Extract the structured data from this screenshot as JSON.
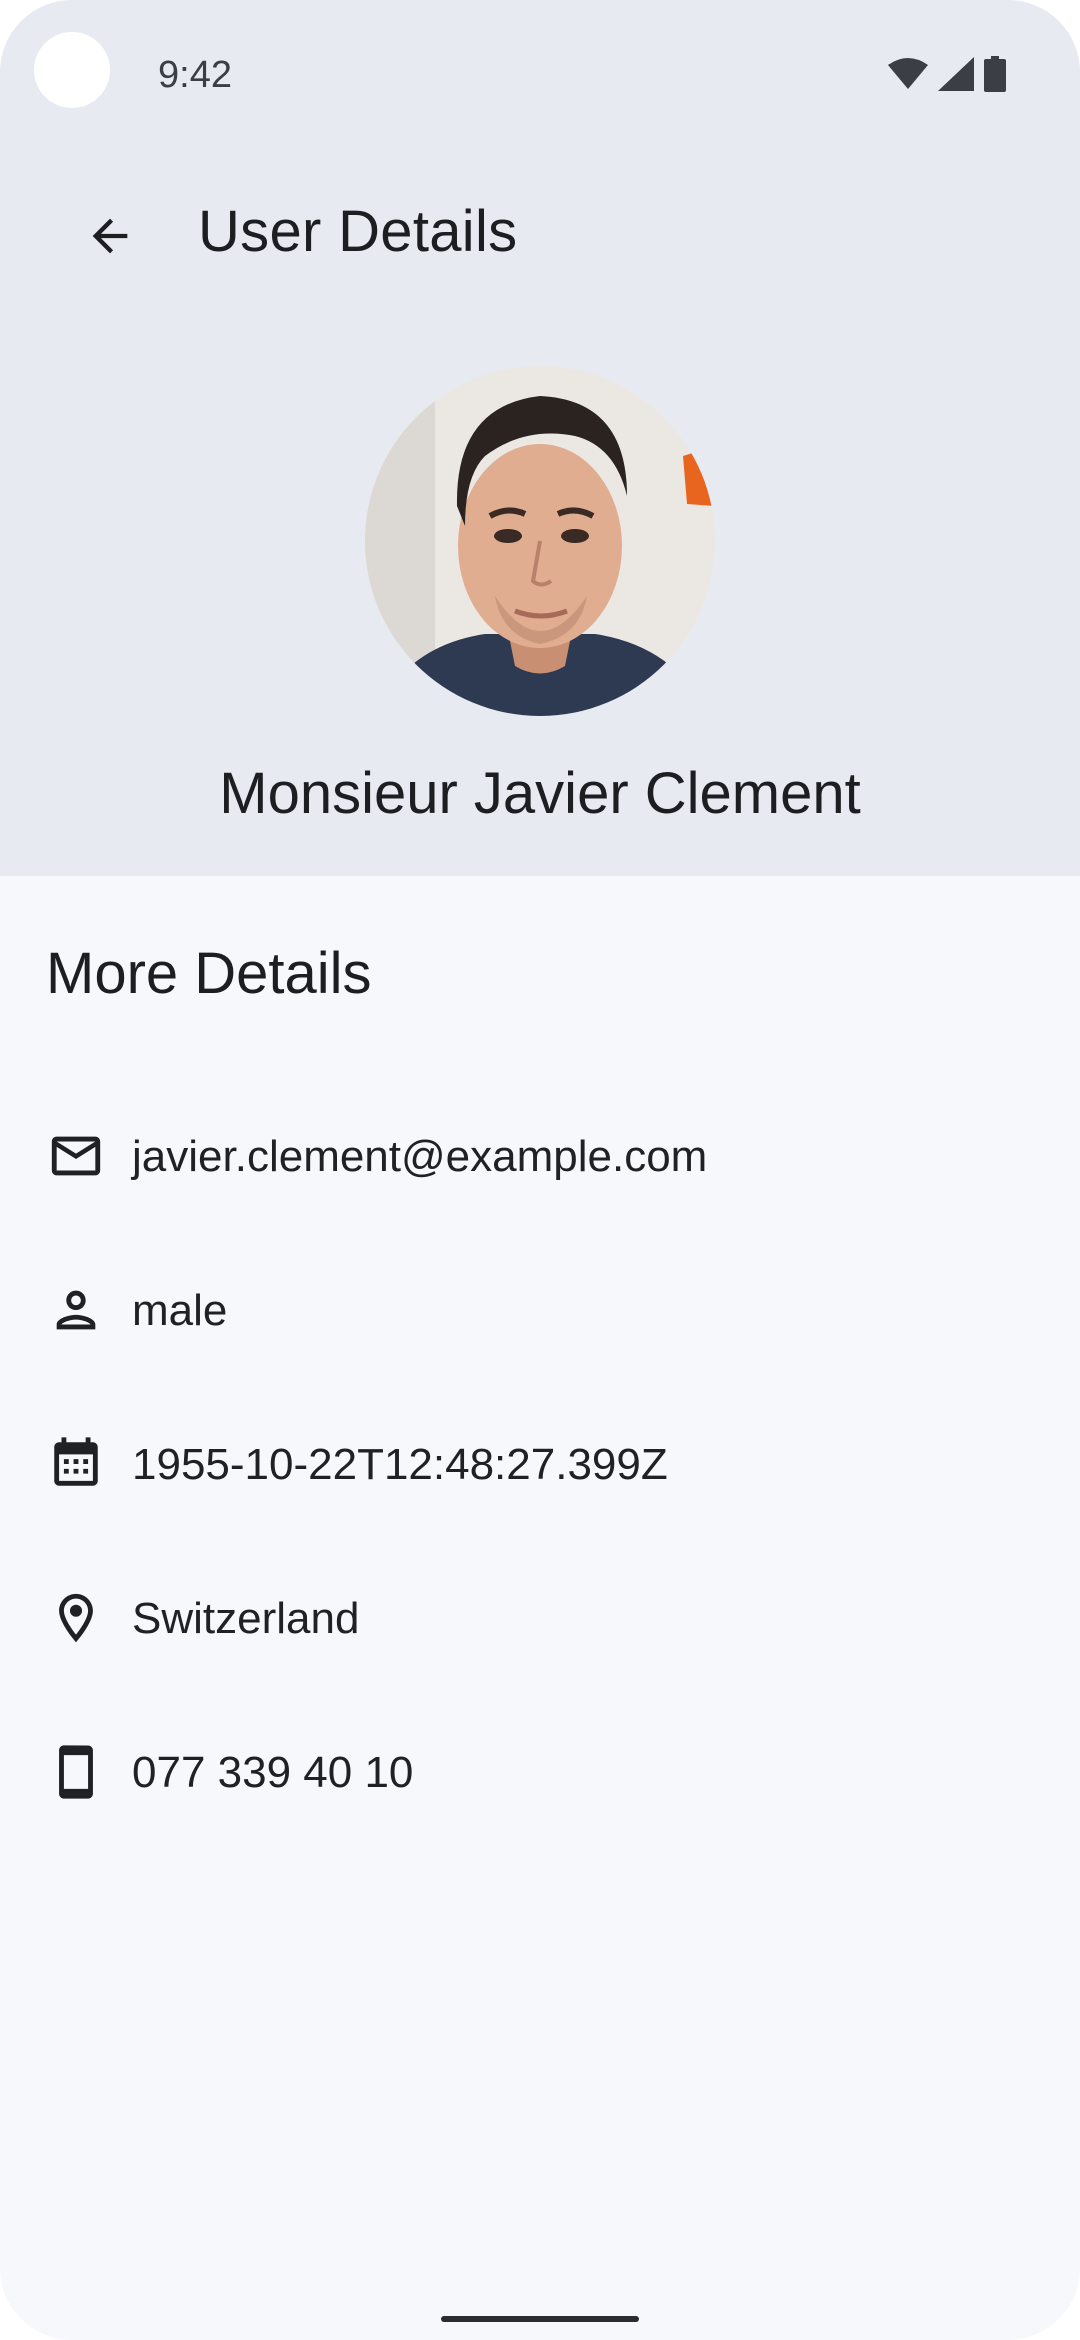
{
  "status_bar": {
    "time": "9:42",
    "icons": [
      "wifi-icon",
      "signal-icon",
      "battery-icon"
    ]
  },
  "top_bar": {
    "back_icon": "arrow-left-icon",
    "title": "User Details"
  },
  "profile": {
    "avatar": "profile-photo",
    "full_name": "Monsieur Javier Clement"
  },
  "details": {
    "section_title": "More Details",
    "rows": [
      {
        "icon": "mail-icon",
        "value": "javier.clement@example.com"
      },
      {
        "icon": "person-icon",
        "value": "male"
      },
      {
        "icon": "calendar-icon",
        "value": "1955-10-22T12:48:27.399Z"
      },
      {
        "icon": "location-pin-icon",
        "value": "Switzerland"
      },
      {
        "icon": "phone-icon",
        "value": "077 339 40 10"
      }
    ]
  },
  "colors": {
    "header_bg": "#e7ebf1",
    "page_bg": "#f6f8fc",
    "text": "#1c1e22"
  }
}
